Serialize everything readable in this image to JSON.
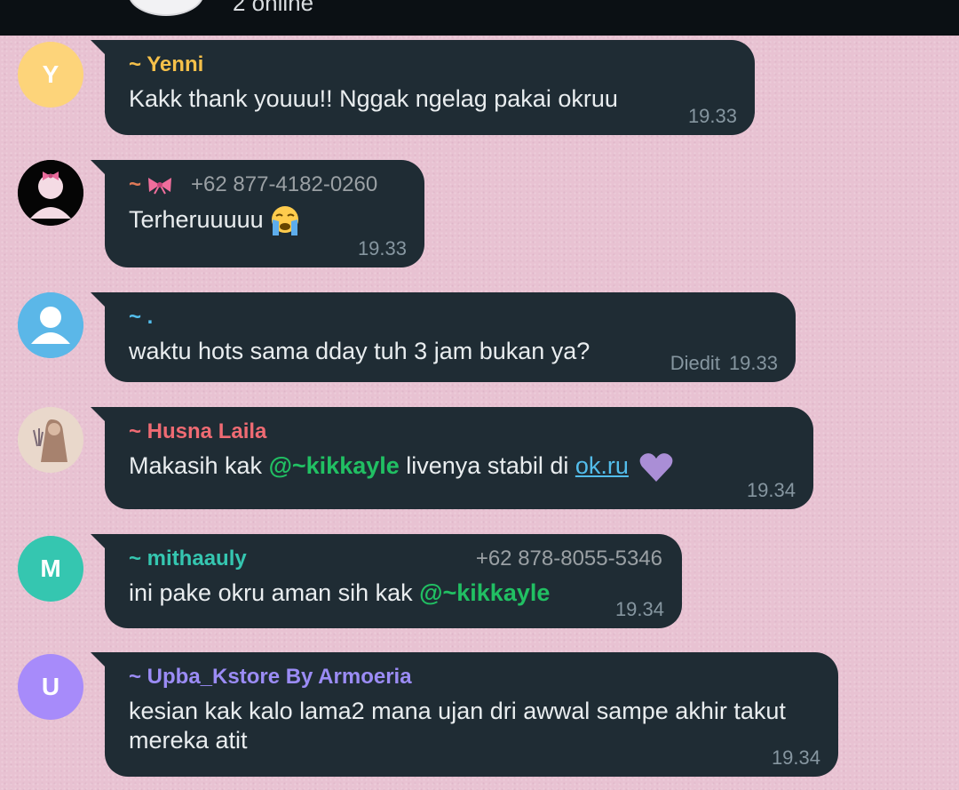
{
  "header": {
    "status_text": "2 online"
  },
  "colors": {
    "bubble": "#1f2c34",
    "message_text": "#e9edef",
    "timestamp": "#8696a0",
    "mention": "#21c063",
    "link": "#53bdeb",
    "wallpaper": "#e8c2d2"
  },
  "messages": [
    {
      "avatar": {
        "letter": "Y",
        "color": "#fdd47a",
        "icon": null
      },
      "sender": "~ Yenni",
      "sender_color": "#f5c04a",
      "text": "Kakk thank youuu!! Nggak ngelag pakai okruu",
      "time": "19.33"
    },
    {
      "avatar": {
        "letter": null,
        "icon": "profile-photo-bow-icon"
      },
      "sender": "~",
      "sender_color": "#e07a58",
      "sender_icon": "pink-bow-icon",
      "phone": "+62 877-4182-0260",
      "text": "Terheruuuuu",
      "text_icon": "loudly-crying-face-icon",
      "time": "19.33"
    },
    {
      "avatar": {
        "letter": null,
        "color": "#5bb7e8",
        "icon": "default-person-icon"
      },
      "sender": "~ .",
      "sender_color": "#53bdeb",
      "text": "waktu hots sama dday tuh 3 jam bukan ya?",
      "edited_label": "Diedit",
      "time": "19.33"
    },
    {
      "avatar": {
        "letter": null,
        "icon": "profile-photo-hijab-icon"
      },
      "sender": "~ Husna Laila",
      "sender_color": "#ef6b73",
      "text_before": "Makasih kak ",
      "mention": "@~kikkayle",
      "text_middle": " livenya stabil di ",
      "link": "ok.ru",
      "text_icon": "purple-heart-icon",
      "time": "19.34"
    },
    {
      "avatar": {
        "letter": "M",
        "color": "#35c6b0",
        "icon": null
      },
      "sender": "~ mithaauly",
      "sender_color": "#35c6b0",
      "phone": "+62 878-8055-5346",
      "text_before": "ini pake okru aman sih kak ",
      "mention": "@~kikkayle",
      "time": "19.34"
    },
    {
      "avatar": {
        "letter": "U",
        "color": "#a78bfa",
        "icon": null
      },
      "sender": "~ Upba_Kstore By Armoeria",
      "sender_color": "#9b8cf5",
      "text": "kesian kak kalo lama2 mana ujan dri awwal sampe akhir takut mereka atit",
      "time": "19.34"
    }
  ]
}
